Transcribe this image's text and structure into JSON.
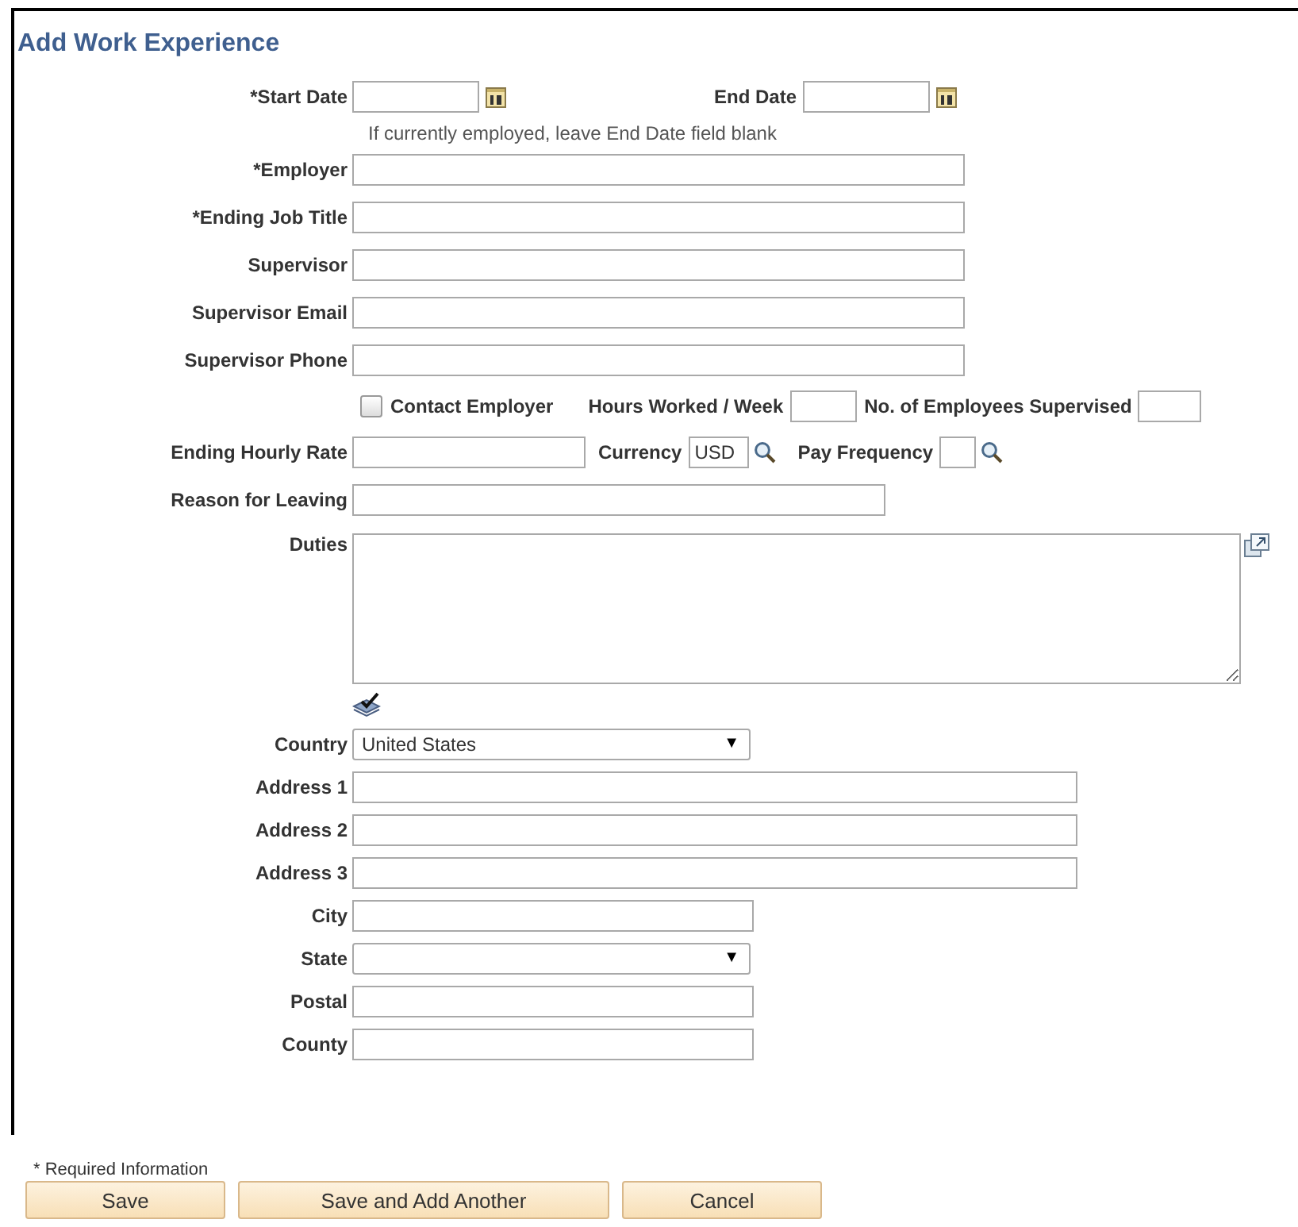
{
  "title": "Add Work Experience",
  "dates": [
    {
      "label": "*Start Date"
    },
    {
      "label": "End Date"
    }
  ],
  "hint": "If currently employed, leave End Date field blank",
  "contact_fields": [
    {
      "label": "*Employer"
    },
    {
      "label": "*Ending Job Title"
    },
    {
      "label": "Supervisor"
    },
    {
      "label": "Supervisor Email"
    },
    {
      "label": "Supervisor Phone"
    }
  ],
  "contact_employer": {
    "label": "Contact Employer",
    "checked": false
  },
  "hours_worked": {
    "label": "Hours Worked / Week"
  },
  "employees_supervised": {
    "label": "No. of Employees Supervised"
  },
  "hourly_rate": {
    "label": "Ending Hourly Rate"
  },
  "currency": {
    "label": "Currency",
    "value": "USD"
  },
  "pay_frequency": {
    "label": "Pay Frequency"
  },
  "reason": {
    "label": "Reason for Leaving"
  },
  "duties": {
    "label": "Duties"
  },
  "address_fields": [
    {
      "label": "Country",
      "kind": "select",
      "value": "United States",
      "arrow": "▼"
    },
    {
      "label": "Address 1",
      "kind": "long"
    },
    {
      "label": "Address 2",
      "kind": "long"
    },
    {
      "label": "Address 3",
      "kind": "long"
    },
    {
      "label": "City",
      "kind": "short"
    },
    {
      "label": "State",
      "kind": "select",
      "arrow": "▼"
    },
    {
      "label": "Postal",
      "kind": "short"
    },
    {
      "label": "County",
      "kind": "short"
    }
  ],
  "footnote": "* Required Information",
  "buttons": [
    "Save",
    "Save and Add Another",
    "Cancel"
  ]
}
